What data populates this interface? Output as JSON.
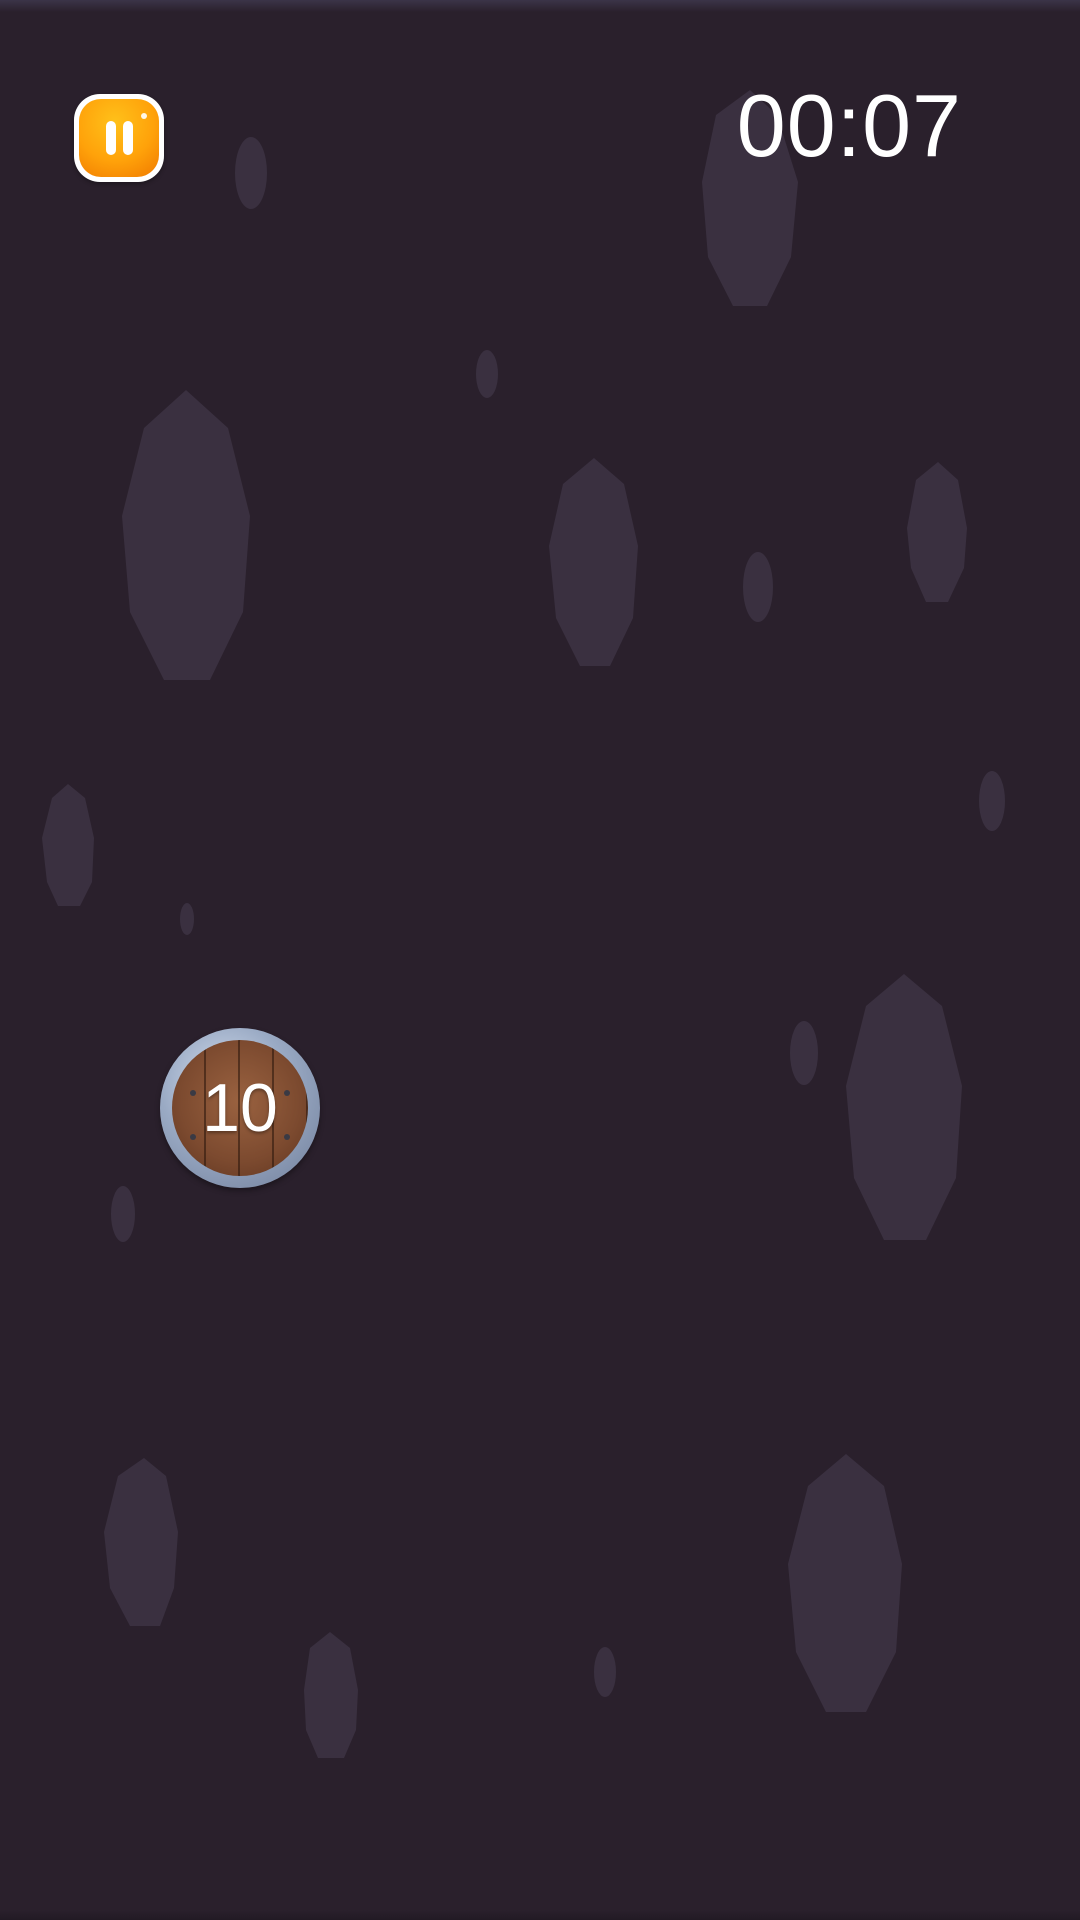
{
  "hud": {
    "timer": "00:07",
    "pause_icon": "pause-icon",
    "accent_color": "#ffa20a"
  },
  "barrel": {
    "value": "10",
    "icon": "wooden-barrel-icon"
  },
  "background": {
    "color": "#2a202c",
    "rock_color": "#3a3040"
  }
}
